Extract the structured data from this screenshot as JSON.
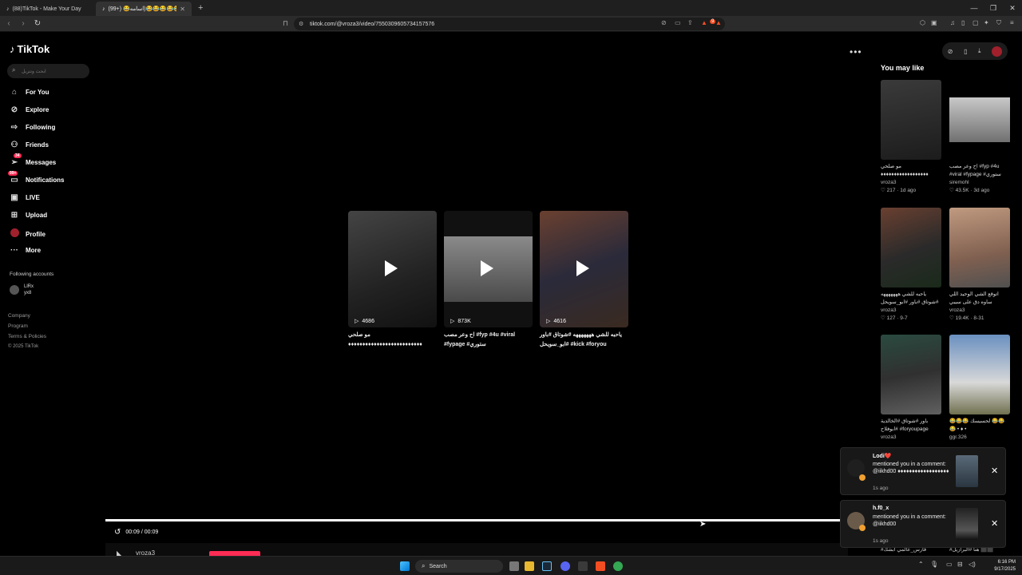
{
  "browser": {
    "tabs": [
      {
        "label": "(88)TikTok - Make Your Day"
      },
      {
        "label": "هههه😂😂😂😂😂(اسامه😂 (+99)"
      }
    ],
    "url": "tiktok.com/@vroza3/video/7550309605734157576",
    "ext_badge": "9"
  },
  "sidebar": {
    "logo": "TikTok",
    "search_placeholder": "ابحث وتنزيل",
    "nav": [
      {
        "label": "For You",
        "icon": "home-icon"
      },
      {
        "label": "Explore",
        "icon": "compass-icon"
      },
      {
        "label": "Following",
        "icon": "following-icon"
      },
      {
        "label": "Friends",
        "icon": "friends-icon"
      },
      {
        "label": "Messages",
        "icon": "messages-icon",
        "badge": "34"
      },
      {
        "label": "Notifications",
        "icon": "bell-icon",
        "badge": "99+"
      },
      {
        "label": "LIVE",
        "icon": "live-icon"
      },
      {
        "label": "Upload",
        "icon": "upload-icon"
      },
      {
        "label": "Profile",
        "icon": "profile-avatar"
      },
      {
        "label": "More",
        "icon": "more-icon"
      }
    ],
    "following_title": "Following accounts",
    "following_account": {
      "name": "LlRx",
      "handle": "yx8"
    },
    "footer": [
      "Company",
      "Program",
      "Terms & Policies",
      "© 2025 TikTok"
    ]
  },
  "player": {
    "time": "00:09 / 00:09",
    "username": "vroza3",
    "progress_fraction": 1.0,
    "related": [
      {
        "views": "4686",
        "title": "مو صلحي ♦♦♦♦♦♦♦♦♦♦♦♦♦♦♦♦♦♦♦♦♦♦♦♦♦♦",
        "color": "#3a3a3a"
      },
      {
        "views": "873K",
        "title": "اح وعر مصب #fyp #4u #viral #fypage #ستوري",
        "color": "#6a6a6a"
      },
      {
        "views": "4616",
        "title": "ياحبه للشي هههههههه #شوتاق #باور #ابو_سويحل #kick #foryou",
        "color": "#5a3a2a"
      }
    ]
  },
  "right_panel": {
    "title": "You may like",
    "cards": [
      {
        "caption": "مو صلحي ♦♦♦♦♦♦♦♦♦♦♦♦♦♦♦♦♦♦",
        "user": "vroza3",
        "likes": "217",
        "age": "1d ago",
        "color": "#2a2a2a"
      },
      {
        "caption": "اح وعر مصب #fyp #4u #viral #fypage #ستوري",
        "user": "siremohl",
        "likes": "43.5K",
        "age": "3d ago",
        "color": "#7a7a7a"
      },
      {
        "caption": "ياحبه للشي هههههههه #شوتاق #باور #ابو_سويحل",
        "user": "vroza3",
        "likes": "127",
        "age": "9-7",
        "color": "#4a3a2a"
      },
      {
        "caption": "اتوقع الشي الوحيد اللي ساوه دق على سيبي #سويمي #كوميدي",
        "user": "vroza3",
        "likes": "19.4K",
        "age": "8-31",
        "color": "#a08070"
      },
      {
        "caption": "باور #شوتاق #الخالدية #ابوفلاح #foryoupage",
        "user": "vroza3",
        "likes": "",
        "age": "",
        "color": "#3a4a4a"
      },
      {
        "caption": "😂😂😂 لحسيسك 😂😂😂 • ♦ •",
        "user": "ggr.326",
        "likes": "",
        "age": "",
        "color": "#8a9ab0"
      }
    ],
    "bottom_captions": [
      "#فارس_عالمي ابشك",
      "#هنا #البرازيل ⬛⬛"
    ]
  },
  "toasts": [
    {
      "name": "Lodi❤️",
      "message": "mentioned you in a comment: @iikhd00 ♦♦♦♦♦♦♦♦♦♦♦♦♦♦♦♦♦♦",
      "ago": "1s ago",
      "avatar_color": "#1f1f1f",
      "thumb_color": "#4a5560"
    },
    {
      "name": "h.f0_x",
      "message": "mentioned you in a comment: @iikhd00",
      "ago": "1s ago",
      "avatar_color": "#6a5a4a",
      "thumb_color": "#222"
    }
  ],
  "taskbar": {
    "search_label": "Search",
    "time": "6:16 PM",
    "date": "9/17/2025"
  },
  "colors": {
    "accent": "#fe2c55",
    "background": "#000000"
  }
}
